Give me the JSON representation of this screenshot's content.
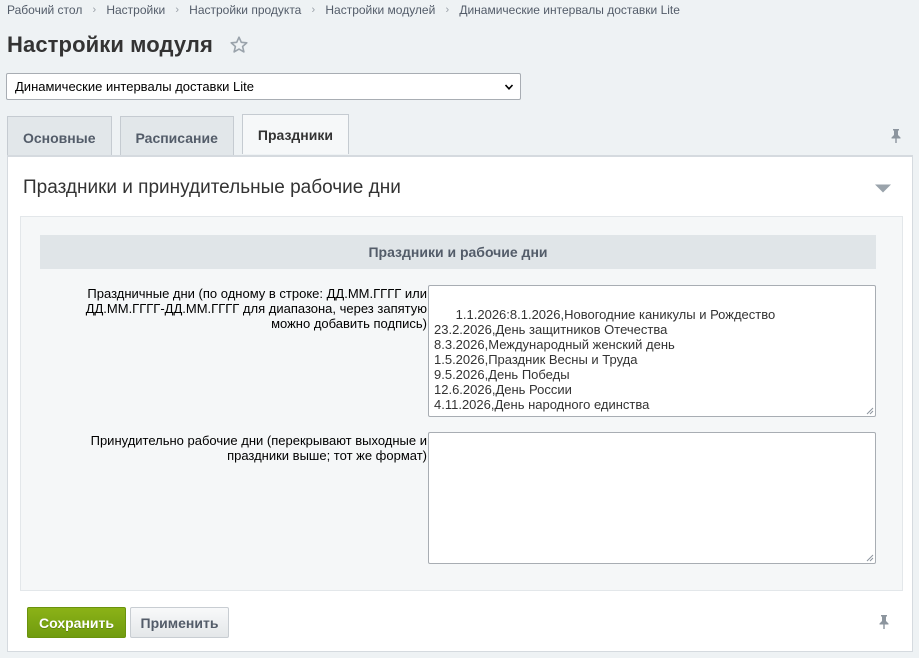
{
  "breadcrumb": {
    "items": [
      "Рабочий стол",
      "Настройки",
      "Настройки продукта",
      "Настройки модулей",
      "Динамические интервалы доставки Lite"
    ],
    "separator": "›"
  },
  "page": {
    "title": "Настройки модуля",
    "star_icon": "star-outline-icon"
  },
  "module_select": {
    "selected": "Динамические интервалы доставки Lite"
  },
  "tabs": [
    {
      "label": "Основные",
      "active": false
    },
    {
      "label": "Расписание",
      "active": false
    },
    {
      "label": "Праздники",
      "active": true
    }
  ],
  "section": {
    "title": "Праздники и принудительные рабочие дни"
  },
  "group": {
    "header": "Праздники и рабочие дни"
  },
  "fields": {
    "holidays": {
      "label": "Праздничные дни (по одному в строке: ДД.ММ.ГГГГ или ДД.ММ.ГГГГ-ДД.ММ.ГГГГ для диапазона, через запятую можно добавить подпись)",
      "value": "1.1.2026:8.1.2026,Новогодние каникулы и Рождество\n23.2.2026,День защитников Отечества\n8.3.2026,Международный женский день\n1.5.2026,Праздник Весны и Труда\n9.5.2026,День Победы\n12.6.2026,День России\n4.11.2026,День народного единства"
    },
    "workdays": {
      "label": "Принудительно рабочие дни (перекрывают выходные и праздники выше; тот же формат)",
      "value": ""
    }
  },
  "buttons": {
    "save": "Сохранить",
    "apply": "Применить"
  },
  "colors": {
    "accent_green": "#7aa414",
    "background": "#eef2f4"
  }
}
